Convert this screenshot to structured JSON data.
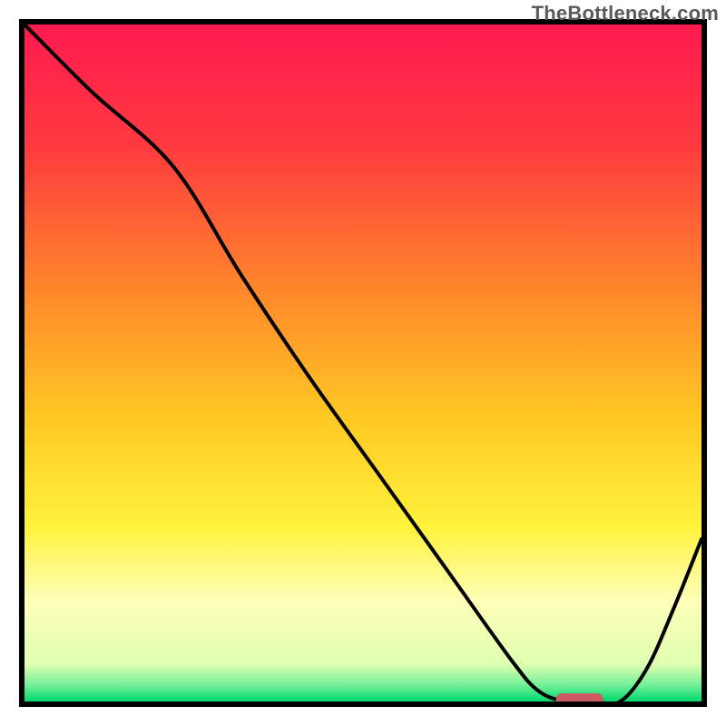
{
  "watermark": "TheBottleneck.com",
  "colors": {
    "border": "#000000",
    "curve": "#000000",
    "marker": "#cd5a62",
    "gradient_stops": [
      {
        "offset": 0.0,
        "color": "#ff1a4f"
      },
      {
        "offset": 0.18,
        "color": "#ff3a3f"
      },
      {
        "offset": 0.4,
        "color": "#ff8a2a"
      },
      {
        "offset": 0.58,
        "color": "#ffc824"
      },
      {
        "offset": 0.74,
        "color": "#fff23a"
      },
      {
        "offset": 0.85,
        "color": "#ffffb8"
      },
      {
        "offset": 0.945,
        "color": "#dfffb0"
      },
      {
        "offset": 0.975,
        "color": "#75f098"
      },
      {
        "offset": 1.0,
        "color": "#00d86f"
      }
    ]
  },
  "chart_data": {
    "type": "line",
    "title": "",
    "xlabel": "",
    "ylabel": "",
    "xlim": [
      0,
      100
    ],
    "ylim": [
      0,
      100
    ],
    "x": [
      0,
      10,
      22,
      32,
      42,
      52,
      62,
      72,
      76,
      80,
      84,
      88,
      92,
      96,
      100
    ],
    "values": [
      100,
      90,
      79,
      63,
      48,
      34,
      20,
      6,
      1.5,
      0,
      0,
      0,
      5,
      14,
      24
    ],
    "optimum_marker": {
      "x_start": 78.5,
      "x_end": 85.5,
      "y": 0
    },
    "annotations": []
  }
}
